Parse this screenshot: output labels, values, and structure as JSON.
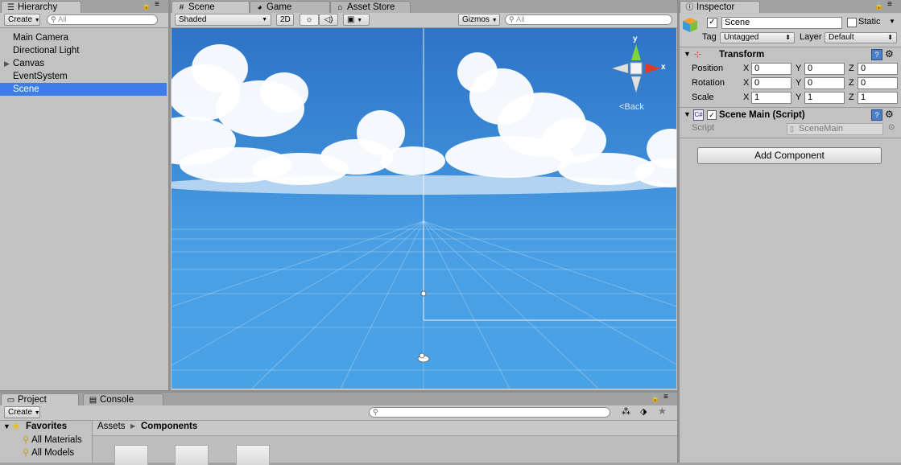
{
  "hierarchy": {
    "tab_label": "Hierarchy",
    "create_label": "Create",
    "search_placeholder": "All",
    "items": [
      {
        "label": "Main Camera"
      },
      {
        "label": "Directional Light"
      },
      {
        "label": "Canvas"
      },
      {
        "label": "EventSystem"
      },
      {
        "label": "Scene"
      }
    ]
  },
  "scene_view": {
    "tabs": [
      "Scene",
      "Game",
      "Asset Store"
    ],
    "shading_mode": "Shaded",
    "mode_2d": "2D",
    "gizmos_label": "Gizmos",
    "search_placeholder": "All",
    "axis_y": "y",
    "axis_x": "x",
    "back_label": "Back"
  },
  "inspector": {
    "tab_label": "Inspector",
    "object_name": "Scene",
    "static_label": "Static",
    "tag_label": "Tag",
    "tag_value": "Untagged",
    "layer_label": "Layer",
    "layer_value": "Default",
    "transform_title": "Transform",
    "position_label": "Position",
    "rotation_label": "Rotation",
    "scale_label": "Scale",
    "axis_x": "X",
    "axis_y": "Y",
    "axis_z": "Z",
    "position": {
      "x": "0",
      "y": "0",
      "z": "0"
    },
    "rotation": {
      "x": "0",
      "y": "0",
      "z": "0"
    },
    "scale": {
      "x": "1",
      "y": "1",
      "z": "1"
    },
    "script_component_title": "Scene Main (Script)",
    "script_label": "Script",
    "script_value": "SceneMain",
    "add_component_label": "Add Component"
  },
  "project": {
    "tabs": [
      "Project",
      "Console"
    ],
    "create_label": "Create",
    "favorites_label": "Favorites",
    "favorites": [
      {
        "label": "All Materials"
      },
      {
        "label": "All Models"
      }
    ],
    "breadcrumb": [
      "Assets",
      "Components"
    ]
  },
  "colors": {
    "selection": "#3e7de7",
    "sky_top": "#2d6fc2",
    "sky_bottom": "#4aa2e6",
    "gizmo_y": "#7fd63a",
    "gizmo_x": "#e23a2a"
  }
}
